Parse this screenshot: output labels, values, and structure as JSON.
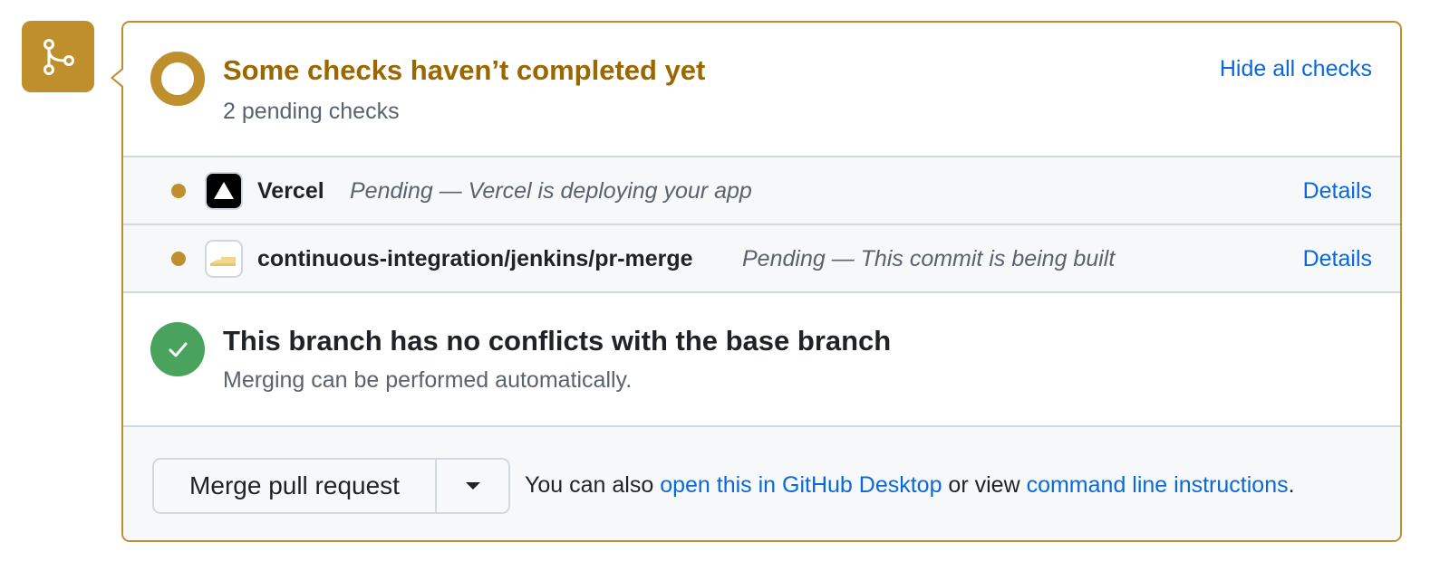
{
  "status": {
    "title": "Some checks haven’t completed yet",
    "subtitle": "2 pending checks",
    "hide_link": "Hide all checks",
    "color": "#bf8f2e"
  },
  "checks": [
    {
      "name": "Vercel",
      "description": "Pending — Vercel is deploying your app",
      "details": "Details",
      "icon": "vercel-logo-icon",
      "status": "pending"
    },
    {
      "name": "continuous-integration/jenkins/pr-merge",
      "description": "Pending — This commit is being built",
      "details": "Details",
      "icon": "jenkins-logo-icon",
      "status": "pending"
    }
  ],
  "conflicts": {
    "title": "This branch has no conflicts with the base branch",
    "subtitle": "Merging can be performed automatically.",
    "color": "#4aa35c"
  },
  "merge": {
    "button_label": "Merge pull request",
    "note_prefix": "You can also ",
    "desktop_link": "open this in GitHub Desktop",
    "note_middle": " or view ",
    "cli_link": "command line instructions",
    "note_suffix": "."
  }
}
